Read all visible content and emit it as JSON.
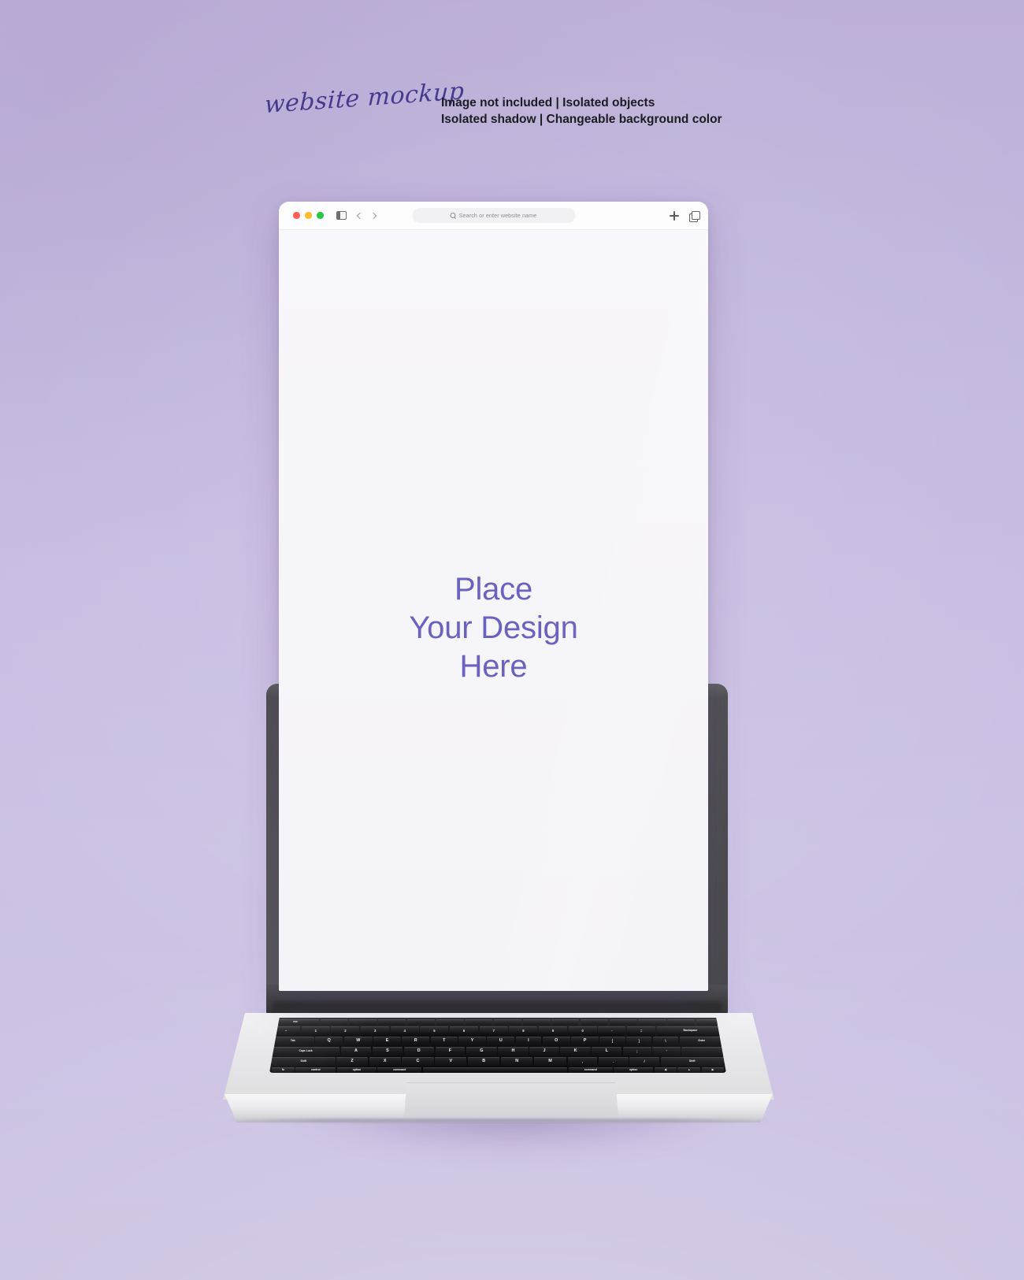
{
  "header": {
    "brand_script": "website mockup",
    "feature_lines": [
      "Image not included  |  Isolated objects",
      "Isolated shadow  |  Changeable background color"
    ]
  },
  "colors": {
    "background_top": "#bdb0d9",
    "background_bottom": "#cbc0e2",
    "accent_text": "#6a62c0",
    "script_purple": "#473a8e",
    "lid_gray": "#5a5a5c",
    "base_silver": "#eaeaec",
    "key_black": "#18181b",
    "traffic_red": "#ff5f57",
    "traffic_yellow": "#febc2e",
    "traffic_green": "#28c840",
    "screen_white": "#f7f6fa"
  },
  "browser": {
    "traffic_lights": [
      {
        "name": "close",
        "color": "#ff5f57"
      },
      {
        "name": "minimize",
        "color": "#febc2e"
      },
      {
        "name": "maximize",
        "color": "#28c840"
      }
    ],
    "sidebar_toggle_label": "Show sidebar",
    "back_label": "Back",
    "forward_label": "Forward",
    "urlbar": {
      "placeholder": "Search or enter website name",
      "value": ""
    },
    "new_tab_label": "New tab",
    "tabs_overview_label": "Tab overview"
  },
  "screen": {
    "placeholder_lines": [
      "Place",
      "Your Design",
      "Here"
    ]
  },
  "keyboard": {
    "rows": [
      {
        "id": "fn",
        "keys": [
          {
            "label": "esc",
            "size": "wide",
            "style": "tiny"
          },
          {
            "label": "",
            "size": ""
          },
          {
            "label": "",
            "size": ""
          },
          {
            "label": "",
            "size": ""
          },
          {
            "label": "",
            "size": ""
          },
          {
            "label": "",
            "size": ""
          },
          {
            "label": "",
            "size": ""
          },
          {
            "label": "",
            "size": ""
          },
          {
            "label": "",
            "size": ""
          },
          {
            "label": "",
            "size": ""
          },
          {
            "label": "",
            "size": ""
          },
          {
            "label": "",
            "size": ""
          },
          {
            "label": "",
            "size": ""
          },
          {
            "label": "",
            "size": ""
          },
          {
            "label": "",
            "size": ""
          }
        ]
      },
      {
        "id": "num",
        "keys": [
          {
            "label": "~",
            "size": ""
          },
          {
            "label": "1",
            "size": ""
          },
          {
            "label": "2",
            "size": ""
          },
          {
            "label": "3",
            "size": ""
          },
          {
            "label": "4",
            "size": ""
          },
          {
            "label": "5",
            "size": ""
          },
          {
            "label": "6",
            "size": ""
          },
          {
            "label": "7",
            "size": ""
          },
          {
            "label": "8",
            "size": ""
          },
          {
            "label": "9",
            "size": ""
          },
          {
            "label": "0",
            "size": ""
          },
          {
            "label": "-",
            "size": ""
          },
          {
            "label": "=",
            "size": ""
          },
          {
            "label": "Backspace",
            "size": "wider",
            "style": "tiny"
          }
        ]
      },
      {
        "id": "q",
        "keys": [
          {
            "label": "Tab",
            "size": "wide",
            "style": "tiny"
          },
          {
            "label": "Q",
            "size": "",
            "style": "letter"
          },
          {
            "label": "W",
            "size": "",
            "style": "letter"
          },
          {
            "label": "E",
            "size": "",
            "style": "letter"
          },
          {
            "label": "R",
            "size": "",
            "style": "letter"
          },
          {
            "label": "T",
            "size": "",
            "style": "letter"
          },
          {
            "label": "Y",
            "size": "",
            "style": "letter"
          },
          {
            "label": "U",
            "size": "",
            "style": "letter"
          },
          {
            "label": "I",
            "size": "",
            "style": "letter"
          },
          {
            "label": "O",
            "size": "",
            "style": "letter"
          },
          {
            "label": "P",
            "size": "",
            "style": "letter"
          },
          {
            "label": "[",
            "size": ""
          },
          {
            "label": "]",
            "size": ""
          },
          {
            "label": "\\",
            "size": ""
          },
          {
            "label": "Enter",
            "size": "wide",
            "style": "tiny"
          }
        ]
      },
      {
        "id": "a",
        "keys": [
          {
            "label": "Caps Lock",
            "size": "wider",
            "style": "tiny"
          },
          {
            "label": "A",
            "size": "",
            "style": "letter"
          },
          {
            "label": "S",
            "size": "",
            "style": "letter"
          },
          {
            "label": "D",
            "size": "",
            "style": "letter"
          },
          {
            "label": "F",
            "size": "",
            "style": "letter"
          },
          {
            "label": "G",
            "size": "",
            "style": "letter"
          },
          {
            "label": "H",
            "size": "",
            "style": "letter"
          },
          {
            "label": "J",
            "size": "",
            "style": "letter"
          },
          {
            "label": "K",
            "size": "",
            "style": "letter"
          },
          {
            "label": "L",
            "size": "",
            "style": "letter"
          },
          {
            "label": ";",
            "size": ""
          },
          {
            "label": "'",
            "size": ""
          },
          {
            "label": "",
            "size": "wide"
          }
        ]
      },
      {
        "id": "z",
        "keys": [
          {
            "label": "Shift",
            "size": "wider",
            "style": "tiny"
          },
          {
            "label": "Z",
            "size": "",
            "style": "letter"
          },
          {
            "label": "X",
            "size": "",
            "style": "letter"
          },
          {
            "label": "C",
            "size": "",
            "style": "letter"
          },
          {
            "label": "V",
            "size": "",
            "style": "letter"
          },
          {
            "label": "B",
            "size": "",
            "style": "letter"
          },
          {
            "label": "N",
            "size": "",
            "style": "letter"
          },
          {
            "label": "M",
            "size": "",
            "style": "letter"
          },
          {
            "label": ",",
            "size": ""
          },
          {
            "label": ".",
            "size": ""
          },
          {
            "label": "/",
            "size": ""
          },
          {
            "label": "Shift",
            "size": "wider",
            "style": "tiny"
          }
        ]
      },
      {
        "id": "sp",
        "keys": [
          {
            "label": "fn",
            "size": "",
            "style": "tiny"
          },
          {
            "label": "control",
            "size": "wide",
            "style": "tiny"
          },
          {
            "label": "option",
            "size": "wide",
            "style": "tiny"
          },
          {
            "label": "command",
            "size": "wide",
            "style": "tiny"
          },
          {
            "label": "",
            "size": "space"
          },
          {
            "label": "command",
            "size": "wide",
            "style": "tiny"
          },
          {
            "label": "option",
            "size": "wide",
            "style": "tiny"
          },
          {
            "label": "◀",
            "size": "",
            "style": "tiny"
          },
          {
            "label": "▲",
            "size": "",
            "style": "tiny"
          },
          {
            "label": "▶",
            "size": "",
            "style": "tiny"
          }
        ]
      }
    ],
    "power_button_label": "power"
  }
}
